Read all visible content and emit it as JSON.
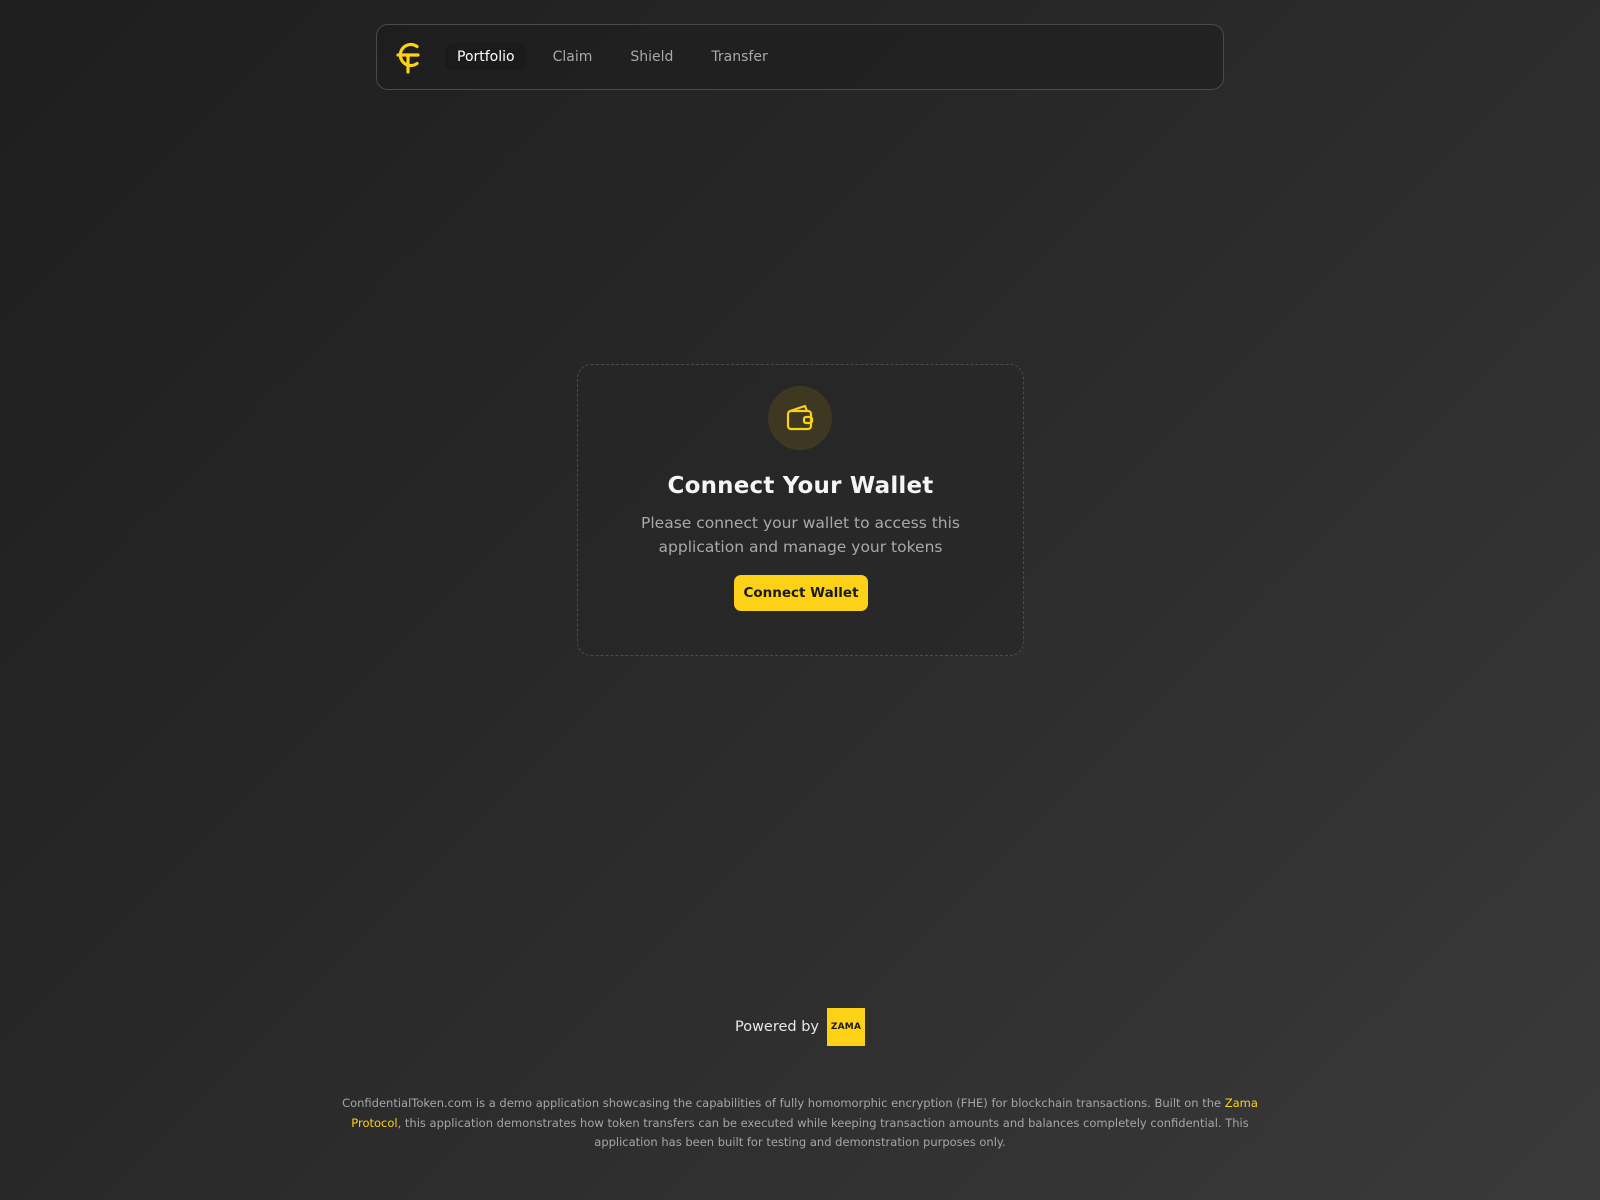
{
  "brand": {
    "logo_icon": "confidential-token-logo-icon",
    "accent": "#fcd116"
  },
  "nav": {
    "items": [
      {
        "label": "Portfolio",
        "active": true
      },
      {
        "label": "Claim",
        "active": false
      },
      {
        "label": "Shield",
        "active": false
      },
      {
        "label": "Transfer",
        "active": false
      }
    ]
  },
  "connect_card": {
    "icon": "wallet-icon",
    "title": "Connect Your Wallet",
    "description": "Please connect your wallet to access this application and manage your tokens",
    "button_label": "Connect Wallet"
  },
  "powered_by": {
    "label": "Powered by",
    "logo_text": "ZAMA"
  },
  "footer": {
    "text_before": "ConfidentialToken.com is a demo application showcasing the capabilities of fully homomorphic encryption (FHE) for blockchain transactions. Built on the ",
    "link_text": "Zama Protocol",
    "text_after": ", this application demonstrates how token transfers can be executed while keeping transaction amounts and balances completely confidential. This application has been built for testing and demonstration purposes only."
  }
}
